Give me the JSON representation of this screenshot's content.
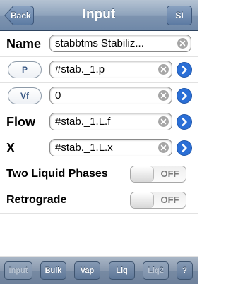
{
  "header": {
    "title": "Input",
    "back_label": "Back",
    "units_label": "SI"
  },
  "rows": {
    "name": {
      "label": "Name",
      "value": "stabbtms Stabiliz..."
    },
    "p": {
      "label": "P",
      "value": "#stab._1.p"
    },
    "vf": {
      "label": "Vf",
      "value": "0"
    },
    "flow": {
      "label": "Flow",
      "value": "#stab._1.L.f"
    },
    "x": {
      "label": "X",
      "value": "#stab._1.L.x"
    }
  },
  "toggles": {
    "two_liquid_phases": {
      "label": "Two Liquid Phases",
      "state": "OFF"
    },
    "retrograde": {
      "label": "Retrograde",
      "state": "OFF"
    }
  },
  "tabbar": {
    "tabs": [
      "Input",
      "Bulk",
      "Vap",
      "Liq",
      "Liq2",
      "?"
    ]
  },
  "colors": {
    "accent": "#2b6fd6",
    "nav": "#6f88a8"
  },
  "icons": {
    "clear": "clear-circle-icon",
    "disclosure": "chevron-right-circle-icon"
  }
}
